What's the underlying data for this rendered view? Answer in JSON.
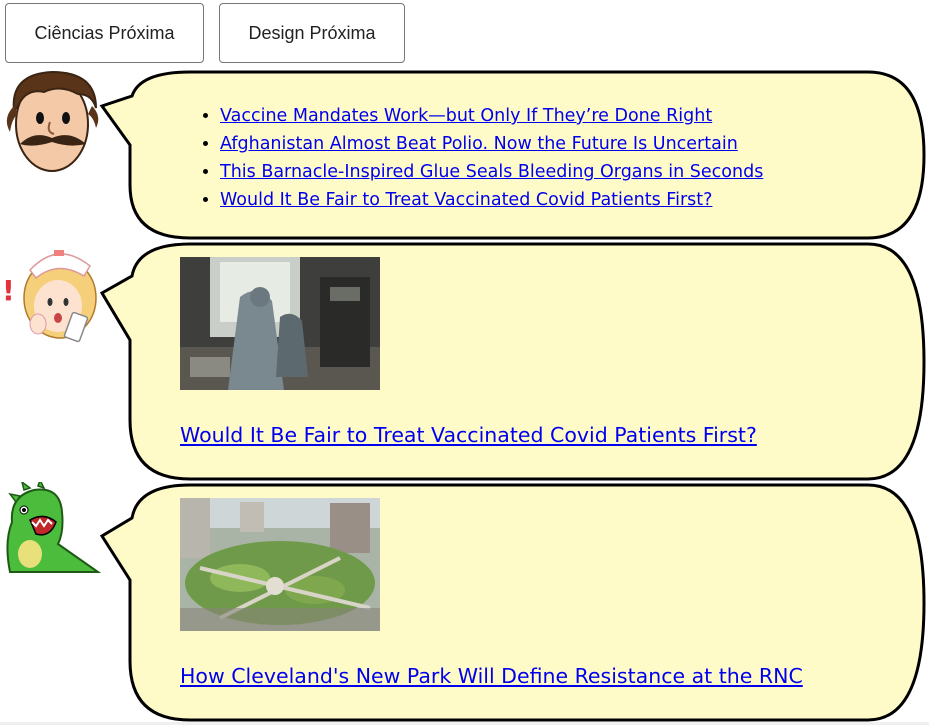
{
  "buttons": {
    "ciencias": "Ciências Próxima",
    "design": "Design Próxima"
  },
  "bubble1": {
    "articles": [
      "Vaccine Mandates Work—but Only If They’re Done Right",
      "Afghanistan Almost Beat Polio. Now the Future Is Uncertain",
      "This Barnacle-Inspired Glue Seals Bleeding Organs in Seconds",
      "Would It Be Fair to Treat Vaccinated Covid Patients First?"
    ]
  },
  "bubble2": {
    "headline": "Would It Be Fair to Treat Vaccinated Covid Patients First?"
  },
  "bubble3": {
    "headline": "How Cleveland's New Park Will Define Resistance at the RNC"
  },
  "colors": {
    "bubble_fill": "#fffbc8",
    "link": "#0000ee"
  }
}
